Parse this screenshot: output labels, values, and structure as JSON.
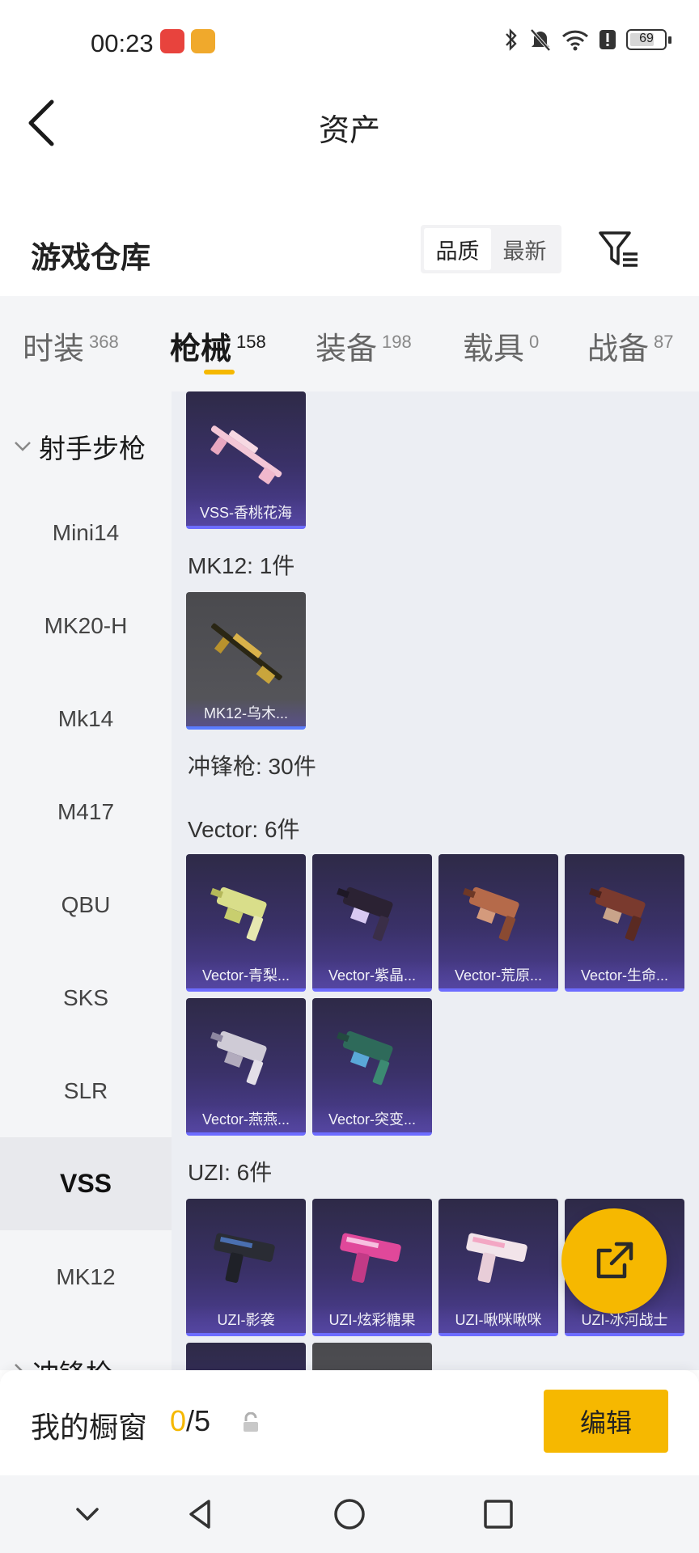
{
  "status_bar": {
    "time": "00:23",
    "battery": "69",
    "icons": [
      "app-red-icon",
      "app-gold-icon",
      "bluetooth-icon",
      "mute-bell-icon",
      "wifi-icon",
      "alert-icon",
      "battery-icon"
    ]
  },
  "header": {
    "title": "资产"
  },
  "warehouse": {
    "title": "游戏仓库",
    "sort_options": [
      "品质",
      "最新"
    ],
    "sort_selected": "品质"
  },
  "tabs": [
    {
      "label": "时装",
      "count": "368"
    },
    {
      "label": "枪械",
      "count": "158",
      "active": true
    },
    {
      "label": "装备",
      "count": "198"
    },
    {
      "label": "载具",
      "count": "0"
    },
    {
      "label": "战备",
      "count": "87"
    }
  ],
  "sidebar": {
    "group_label": "射手步枪",
    "items": [
      "Mini14",
      "MK20-H",
      "Mk14",
      "M417",
      "QBU",
      "SKS",
      "SLR",
      "VSS",
      "MK12"
    ],
    "active_item": "VSS",
    "next_group_label": "冲锋枪"
  },
  "content": {
    "vss_items": [
      "VSS-香桃花海"
    ],
    "mk12_label": "MK12: 1件",
    "mk12_items": [
      "MK12-乌木..."
    ],
    "smg_label": "冲锋枪: 30件",
    "vector_label": "Vector: 6件",
    "vector_items": [
      "Vector-青梨...",
      "Vector-紫晶...",
      "Vector-荒原...",
      "Vector-生命...",
      "Vector-燕燕...",
      "Vector-突变..."
    ],
    "uzi_label": "UZI: 6件",
    "uzi_items": [
      "UZI-影袭",
      "UZI-炫彩糖果",
      "UZI-啾咪啾咪",
      "UZI-冰河战士"
    ]
  },
  "bottom": {
    "window_title": "我的橱窗",
    "count_current": "0",
    "count_total": "/5",
    "edit_label": "编辑"
  },
  "colors": {
    "accent": "#f6b800",
    "card_bg": "#3a3168",
    "card_border": "#6d6cff"
  }
}
